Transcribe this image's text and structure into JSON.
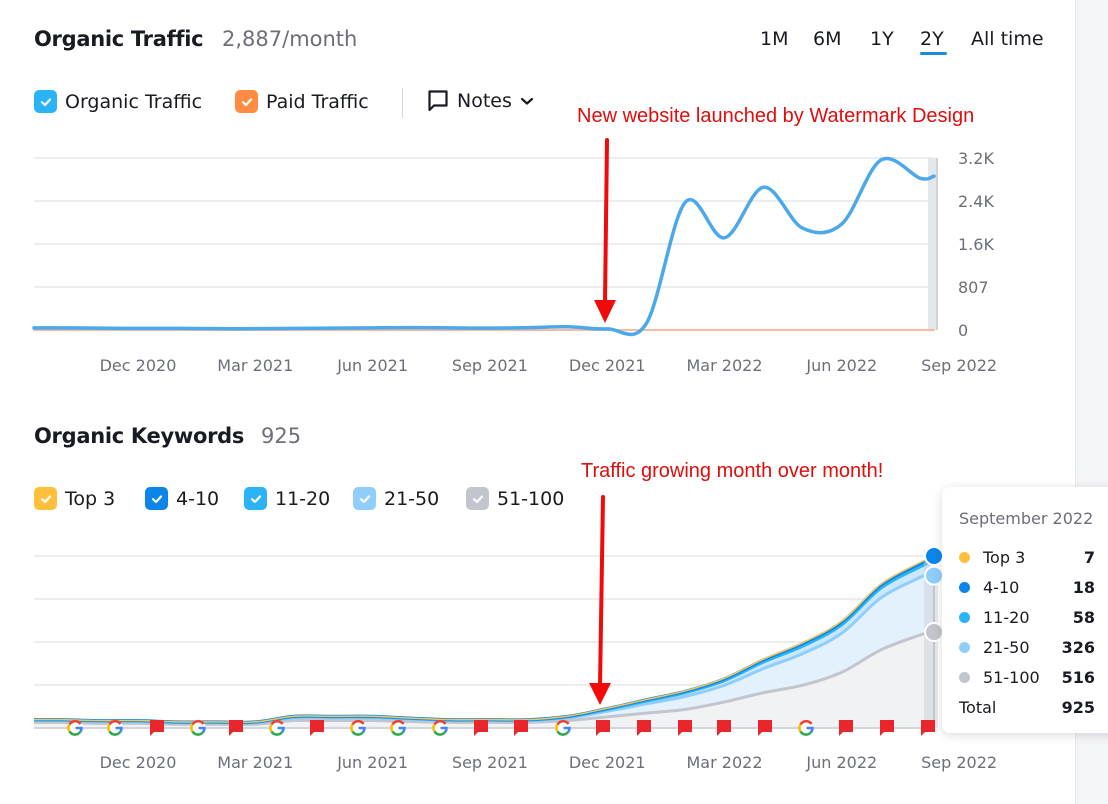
{
  "traffic": {
    "title": "Organic Traffic",
    "value": "2,887/month",
    "periods": [
      {
        "label": "1M",
        "active": false
      },
      {
        "label": "6M",
        "active": false
      },
      {
        "label": "1Y",
        "active": false
      },
      {
        "label": "2Y",
        "active": true
      },
      {
        "label": "All time",
        "active": false
      }
    ],
    "legend": [
      {
        "label": "Organic Traffic",
        "color": "#2bb3f7",
        "checked": true
      },
      {
        "label": "Paid Traffic",
        "color": "#ff8c42",
        "checked": true
      }
    ],
    "notes_label": "Notes",
    "annotation": "New website launched by Watermark Design"
  },
  "keywords": {
    "title": "Organic Keywords",
    "value": "925",
    "legend": [
      {
        "label": "Top 3",
        "color": "#ffbf3b",
        "checked": true
      },
      {
        "label": "4-10",
        "color": "#0b86e8",
        "checked": true
      },
      {
        "label": "11-20",
        "color": "#2bb3f7",
        "checked": true
      },
      {
        "label": "21-50",
        "color": "#8fcdfb",
        "checked": true
      },
      {
        "label": "51-100",
        "color": "#c2c5cd",
        "checked": true
      }
    ],
    "annotation": "Traffic growing month over month!",
    "tooltip": {
      "title": "September 2022",
      "rows": [
        {
          "label": "Top 3",
          "value": "7",
          "color": "#ffbf3b"
        },
        {
          "label": "4-10",
          "value": "18",
          "color": "#0b86e8"
        },
        {
          "label": "11-20",
          "value": "58",
          "color": "#2bb3f7"
        },
        {
          "label": "21-50",
          "value": "326",
          "color": "#8fcdfb"
        },
        {
          "label": "51-100",
          "value": "516",
          "color": "#c2c5cd"
        }
      ],
      "total_label": "Total",
      "total_value": "925"
    }
  },
  "chart_data": [
    {
      "type": "line",
      "title": "Organic Traffic",
      "x": [
        "Sep 2020",
        "Oct 2020",
        "Nov 2020",
        "Dec 2020",
        "Jan 2021",
        "Feb 2021",
        "Mar 2021",
        "Apr 2021",
        "May 2021",
        "Jun 2021",
        "Jul 2021",
        "Aug 2021",
        "Sep 2021",
        "Oct 2021",
        "Nov 2021",
        "Dec 2021",
        "Jan 2022",
        "Feb 2022",
        "Mar 2022",
        "Apr 2022",
        "May 2022",
        "Jun 2022",
        "Jul 2022",
        "Aug 2022",
        "Sep 2022"
      ],
      "x_tick_labels": [
        "Dec 2020",
        "Mar 2021",
        "Jun 2021",
        "Sep 2021",
        "Dec 2021",
        "Mar 2022",
        "Jun 2022",
        "Sep 2022"
      ],
      "y_tick_labels": [
        "0",
        "807",
        "1.6K",
        "2.4K",
        "3.2K"
      ],
      "ylim": [
        0,
        3228
      ],
      "grid": true,
      "series": [
        {
          "name": "Organic Traffic",
          "color": "#4ba8ea",
          "values": [
            40,
            40,
            35,
            30,
            30,
            25,
            25,
            30,
            35,
            40,
            45,
            40,
            35,
            45,
            60,
            20,
            120,
            2400,
            1730,
            2680,
            1910,
            1990,
            3190,
            2850,
            2887
          ]
        },
        {
          "name": "Paid Traffic",
          "color": "#ff8c42",
          "values": [
            0,
            0,
            0,
            0,
            0,
            0,
            0,
            0,
            0,
            0,
            0,
            0,
            0,
            0,
            0,
            0,
            0,
            0,
            0,
            0,
            0,
            0,
            0,
            0,
            0
          ]
        }
      ],
      "annotation": {
        "text": "New website launched by Watermark Design",
        "x": "Dec 2021"
      }
    },
    {
      "type": "area",
      "title": "Organic Keywords",
      "stacked": true,
      "x": [
        "Sep 2020",
        "Oct 2020",
        "Nov 2020",
        "Dec 2020",
        "Jan 2021",
        "Feb 2021",
        "Mar 2021",
        "Apr 2021",
        "May 2021",
        "Jun 2021",
        "Jul 2021",
        "Aug 2021",
        "Sep 2021",
        "Oct 2021",
        "Nov 2021",
        "Dec 2021",
        "Jan 2022",
        "Feb 2022",
        "Mar 2022",
        "Apr 2022",
        "May 2022",
        "Jun 2022",
        "Jul 2022",
        "Aug 2022",
        "Sep 2022"
      ],
      "x_tick_labels": [
        "Dec 2020",
        "Mar 2021",
        "Jun 2021",
        "Sep 2021",
        "Dec 2021",
        "Mar 2022",
        "Jun 2022",
        "Sep 2022"
      ],
      "ylim": [
        0,
        925
      ],
      "grid": true,
      "series": [
        {
          "name": "51-100",
          "color": "#c2c5cd",
          "values": [
            30,
            30,
            25,
            25,
            20,
            20,
            20,
            40,
            40,
            40,
            35,
            30,
            30,
            30,
            40,
            60,
            80,
            100,
            140,
            190,
            230,
            300,
            420,
            500,
            516
          ]
        },
        {
          "name": "21-50",
          "color": "#8fcdfb",
          "values": [
            10,
            10,
            10,
            10,
            8,
            8,
            8,
            15,
            15,
            15,
            12,
            10,
            10,
            10,
            15,
            30,
            50,
            70,
            90,
            130,
            170,
            210,
            280,
            310,
            326
          ]
        },
        {
          "name": "11-20",
          "color": "#2bb3f7",
          "values": [
            3,
            3,
            3,
            3,
            3,
            3,
            3,
            5,
            5,
            5,
            4,
            3,
            3,
            3,
            5,
            10,
            15,
            20,
            25,
            35,
            40,
            45,
            52,
            56,
            58
          ]
        },
        {
          "name": "4-10",
          "color": "#0b86e8",
          "values": [
            2,
            2,
            2,
            2,
            2,
            2,
            2,
            3,
            3,
            3,
            2,
            2,
            2,
            2,
            3,
            5,
            7,
            8,
            10,
            12,
            14,
            15,
            16,
            17,
            18
          ]
        },
        {
          "name": "Top 3",
          "color": "#ffbf3b",
          "values": [
            0,
            0,
            0,
            0,
            0,
            0,
            0,
            0,
            0,
            0,
            0,
            0,
            0,
            0,
            1,
            1,
            1,
            2,
            3,
            4,
            5,
            5,
            6,
            7,
            7
          ]
        }
      ],
      "markers": [
        "google",
        "google",
        "note",
        "google",
        "note",
        "google",
        "note",
        "google",
        "google",
        "google",
        "note",
        "note",
        "google",
        "note",
        "note",
        "note",
        "note",
        "note",
        "google",
        "note",
        "note",
        "note"
      ],
      "annotation": {
        "text": "Traffic growing month over month!",
        "x": "Dec 2021"
      }
    }
  ]
}
